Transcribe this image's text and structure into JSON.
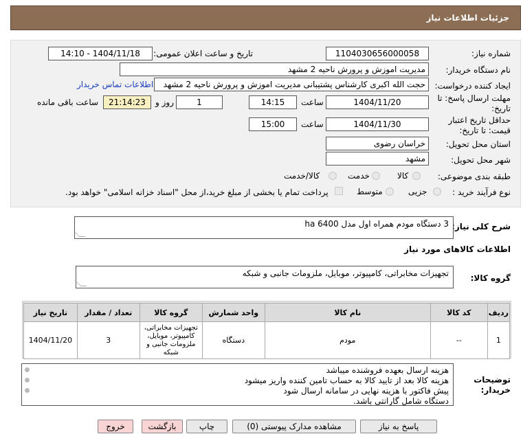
{
  "header": {
    "title": "جزئیات اطلاعات نیاز"
  },
  "form": {
    "need_number_label": "شماره نیاز:",
    "need_number": "1104030656000058",
    "announce_label": "تاریخ و ساعت اعلان عمومی:",
    "announce_value": "1404/11/18 - 14:10",
    "buyer_org_label": "نام دستگاه خریدار:",
    "buyer_org": "مدیریت اموزش و پرورش ناحیه 2 مشهد",
    "requester_label": "ایجاد کننده درخواست:",
    "requester": "حجت الله اکبری کارشناس پشتیبانی مدیریت اموزش و پرورش ناحیه 2 مشهد",
    "contact_link": "اطلاعات تماس خریدار",
    "reply_deadline_label_1": "مهلت ارسال پاسخ: تا",
    "reply_deadline_label_2": "تاریخ:",
    "reply_date": "1404/11/20",
    "time_label": "ساعت",
    "reply_time": "14:15",
    "days_value": "1",
    "days_label": "روز و",
    "remaining_time": "21:14:23",
    "remaining_label": "ساعت باقی مانده",
    "price_validity_label_1": "حداقل تاریخ اعتبار",
    "price_validity_label_2": "قیمت: تا تاریخ:",
    "validity_date": "1404/11/30",
    "validity_time_label": "ساعت",
    "validity_time": "15:00",
    "province_label": "استان محل تحویل:",
    "province": "خراسان رضوی",
    "city_label": "شهر محل تحویل:",
    "city": "مشهد",
    "category_label": "طبقه بندی موضوعی:",
    "category_options": [
      "کالا",
      "خدمت",
      "کالا/خدمت"
    ],
    "process_label": "نوع فرآیند خرید :",
    "process_options": [
      "جزیی",
      "متوسط"
    ],
    "payment_note": "پرداخت تمام یا بخشی از مبلغ خرید،از محل \"اسناد خزانه اسلامی\" خواهد بود."
  },
  "summary": {
    "label": "شرح کلی نیاز:",
    "value": "3 دستگاه مودم همراه اول مدل  ha 6400"
  },
  "goods_info": {
    "title": "اطلاعات کالاهای مورد نیاز",
    "group_label": "گروه کالا:",
    "group_value": "تجهیزات مخابراتی، کامپیوتر، موبایل، ملزومات جانبی و شبکه"
  },
  "table": {
    "headers": [
      "ردیف",
      "کد کالا",
      "نام کالا",
      "واحد شمارش",
      "گروه کالا",
      "تعداد / مقدار",
      "تاریخ نیاز"
    ],
    "rows": [
      [
        "1",
        "--",
        "مودم",
        "دستگاه",
        "تجهیزات مخابراتی، کامپیوتر، موبایل، ملزومات جانبی و شبکه",
        "3",
        "1404/11/20"
      ]
    ]
  },
  "notes": {
    "label_1": "توضیحات",
    "label_2": "خریدار:",
    "lines": [
      "هزینه ارسال بعهده فروشنده میباشد",
      "هزینه کالا بعد از تایید کالا به حساب تامین کننده واریز میشود",
      "پیش فاکتور با هزینه نهایی در سامانه ارسال شود",
      "دستگاه شامل گارانتی باشد."
    ]
  },
  "buttons": {
    "reply": "پاسخ به نیاز",
    "attachments": "مشاهده مدارک پیوستی (0)",
    "print": "چاپ",
    "back": "بازگشت",
    "exit": "خروج"
  },
  "colors": {
    "header_bg": "#8b6e54",
    "panel_bg": "#f1f1f1",
    "highlight": "#f8f0c0",
    "link": "#1a3fbf"
  }
}
